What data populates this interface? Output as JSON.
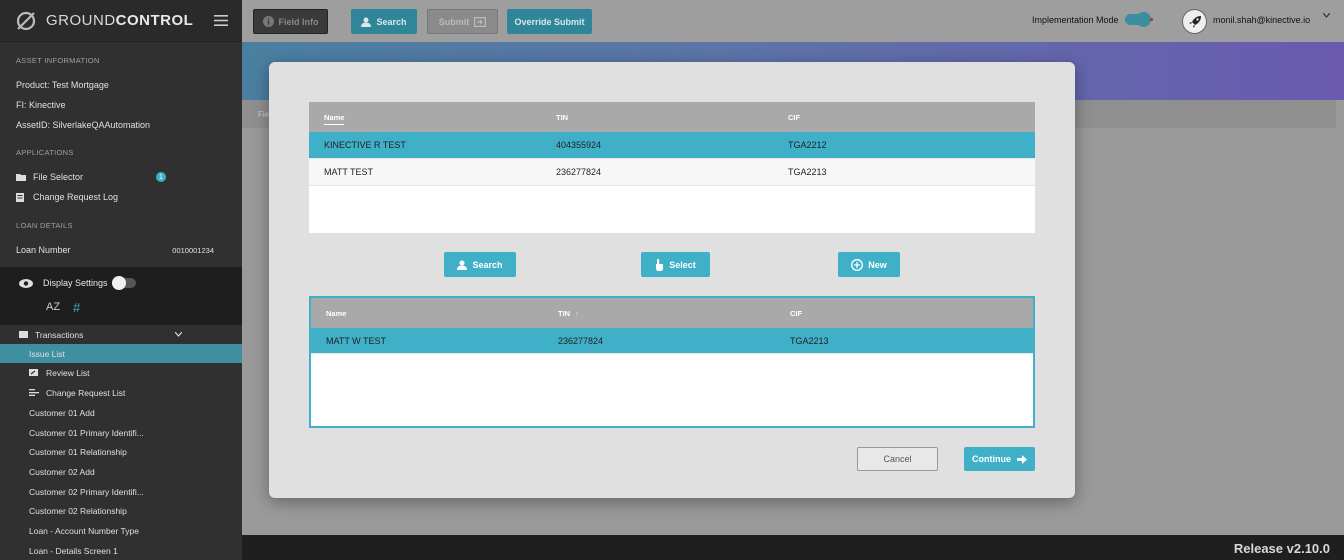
{
  "app": {
    "brand_light": "GROUND",
    "brand_bold": "CONTROL",
    "release": "Release v2.10.0"
  },
  "sidebar": {
    "asset_info_header": "ASSET INFORMATION",
    "product": "Product:  Test Mortgage",
    "fi": "FI:  Kinective",
    "asset_id": "AssetID:  SilverlakeQAAutomation",
    "applications_header": "APPLICATIONS",
    "file_selector": "File Selector",
    "file_selector_badge": "1",
    "change_request_log": "Change Request Log",
    "loan_details_header": "LOAN DETAILS",
    "loan_number_label": "Loan Number",
    "loan_number_value": "0010001234",
    "display_settings": "Display Settings",
    "sort_az": "AZ",
    "sort_hash": "#",
    "transactions": "Transactions",
    "nav": [
      {
        "label": "Issue List",
        "icon": "none"
      },
      {
        "label": "Review List",
        "icon": "review-icon"
      },
      {
        "label": "Change Request List",
        "icon": "change-request-icon"
      },
      {
        "label": "Customer 01 Add",
        "icon": "none"
      },
      {
        "label": "Customer 01 Primary Identifi...",
        "icon": "none"
      },
      {
        "label": "Customer 01 Relationship",
        "icon": "none"
      },
      {
        "label": "Customer 02 Add",
        "icon": "none"
      },
      {
        "label": "Customer 02 Primary Identifi...",
        "icon": "none"
      },
      {
        "label": "Customer 02 Relationship",
        "icon": "none"
      },
      {
        "label": "Loan - Account Number Type",
        "icon": "none"
      },
      {
        "label": "Loan - Details Screen 1",
        "icon": "none"
      }
    ]
  },
  "topbar": {
    "field_info": "Field Info",
    "search": "Search",
    "submit": "Submit",
    "override_submit": "Override Submit",
    "implementation_mode": "Implementation Mode",
    "user_email": "monil.shah@kinective.io"
  },
  "background": {
    "subbar_label": "Fie"
  },
  "modal": {
    "top_table": {
      "headers": [
        "Name",
        "TIN",
        "CIF"
      ],
      "rows": [
        [
          "KINECTIVE R TEST",
          "404355924",
          "TGA2212"
        ],
        [
          "MATT TEST",
          "236277824",
          "TGA2213"
        ]
      ]
    },
    "buttons": {
      "search": "Search",
      "select": "Select",
      "new": "New"
    },
    "bottom_table": {
      "headers": [
        "Name",
        "TIN",
        "CIF"
      ],
      "rows": [
        [
          "MATT W TEST",
          "236277824",
          "TGA2213"
        ]
      ]
    },
    "cancel": "Cancel",
    "continue": "Continue"
  },
  "colors": {
    "accent": "#3fb0c8",
    "sidebar": "#303030",
    "active_nav": "#3e8fa0"
  }
}
